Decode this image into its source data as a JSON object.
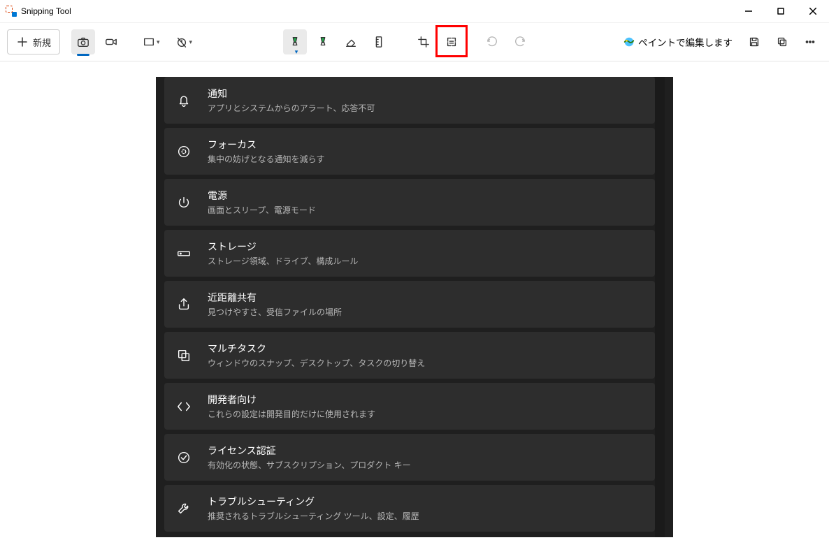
{
  "title": "Snipping Tool",
  "toolbar": {
    "new_label": "新規",
    "edit_paint_label": "ペイントで編集します"
  },
  "settings": [
    {
      "title": "通知",
      "desc": "アプリとシステムからのアラート、応答不可",
      "icon": "bell"
    },
    {
      "title": "フォーカス",
      "desc": "集中の妨げとなる通知を減らす",
      "icon": "focus"
    },
    {
      "title": "電源",
      "desc": "画面とスリープ、電源モード",
      "icon": "power"
    },
    {
      "title": "ストレージ",
      "desc": "ストレージ領域、ドライブ、構成ルール",
      "icon": "storage"
    },
    {
      "title": "近距離共有",
      "desc": "見つけやすさ、受信ファイルの場所",
      "icon": "share"
    },
    {
      "title": "マルチタスク",
      "desc": "ウィンドウのスナップ、デスクトップ、タスクの切り替え",
      "icon": "multitask"
    },
    {
      "title": "開発者向け",
      "desc": "これらの設定は開発目的だけに使用されます",
      "icon": "dev"
    },
    {
      "title": "ライセンス認証",
      "desc": "有効化の状態、サブスクリプション、プロダクト キー",
      "icon": "check"
    },
    {
      "title": "トラブルシューティング",
      "desc": "推奨されるトラブルシューティング ツール、設定、履歴",
      "icon": "wrench"
    }
  ]
}
